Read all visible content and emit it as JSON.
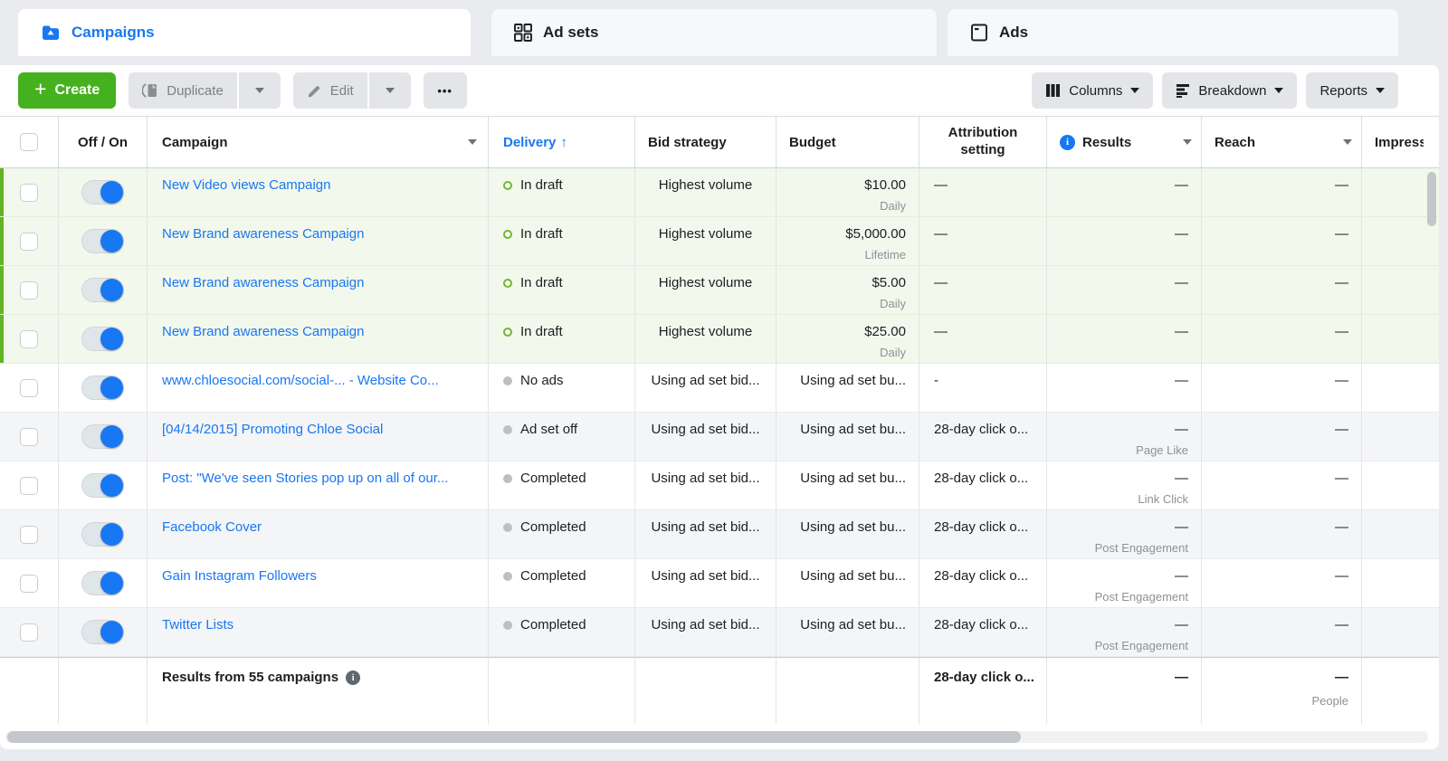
{
  "colors": {
    "accent_blue": "#1877f2",
    "create_green": "#45b11f",
    "draft_accent_green": "#63b324",
    "draft_row_bg": "#f2f8ec",
    "status_dot_gray": "#bcc0c5",
    "draft_ring_green": "#71b62c"
  },
  "tabs": [
    {
      "label": "Campaigns",
      "icon": "folder-icon",
      "active": true
    },
    {
      "label": "Ad sets",
      "icon": "grid-icon",
      "active": false
    },
    {
      "label": "Ads",
      "icon": "ad-page-icon",
      "active": false
    }
  ],
  "toolbar": {
    "create": "Create",
    "duplicate": "Duplicate",
    "edit": "Edit",
    "more": "•••",
    "columns": "Columns",
    "breakdown": "Breakdown",
    "reports": "Reports"
  },
  "table": {
    "headers": {
      "on_off": "Off / On",
      "campaign": "Campaign",
      "delivery": "Delivery",
      "delivery_sort": "↑",
      "bid": "Bid strategy",
      "budget": "Budget",
      "attribution": "Attribution setting",
      "results": "Results",
      "reach": "Reach",
      "impressions": "Impressions"
    },
    "rows": [
      {
        "name": "New Video views Campaign",
        "status": "In draft",
        "status_type": "draft",
        "bid": "Highest volume",
        "budget": "$10.00",
        "budget_period": "Daily",
        "attribution": "—",
        "result": "—",
        "result_label": "",
        "reach": "—",
        "style": "draft"
      },
      {
        "name": "New Brand awareness Campaign",
        "status": "In draft",
        "status_type": "draft",
        "bid": "Highest volume",
        "budget": "$5,000.00",
        "budget_period": "Lifetime",
        "attribution": "—",
        "result": "—",
        "result_label": "",
        "reach": "—",
        "style": "draft"
      },
      {
        "name": "New Brand awareness Campaign",
        "status": "In draft",
        "status_type": "draft",
        "bid": "Highest volume",
        "budget": "$5.00",
        "budget_period": "Daily",
        "attribution": "—",
        "result": "—",
        "result_label": "",
        "reach": "—",
        "style": "draft"
      },
      {
        "name": "New Brand awareness Campaign",
        "status": "In draft",
        "status_type": "draft",
        "bid": "Highest volume",
        "budget": "$25.00",
        "budget_period": "Daily",
        "attribution": "—",
        "result": "—",
        "result_label": "",
        "reach": "—",
        "style": "draft"
      },
      {
        "name": "www.chloesocial.com/social-... - Website Co...",
        "status": "No ads",
        "status_type": "off",
        "bid": "Using ad set bid...",
        "budget": "Using ad set bu...",
        "budget_period": "",
        "attribution": "-",
        "result": "—",
        "result_label": "",
        "reach": "—",
        "style": "plain"
      },
      {
        "name": "[04/14/2015] Promoting Chloe Social",
        "status": "Ad set off",
        "status_type": "off",
        "bid": "Using ad set bid...",
        "budget": "Using ad set bu...",
        "budget_period": "",
        "attribution": "28-day click o...",
        "result": "—",
        "result_label": "Page Like",
        "reach": "—",
        "style": "alt"
      },
      {
        "name": "Post: \"We've seen Stories pop up on all of our...",
        "status": "Completed",
        "status_type": "off",
        "bid": "Using ad set bid...",
        "budget": "Using ad set bu...",
        "budget_period": "",
        "attribution": "28-day click o...",
        "result": "—",
        "result_label": "Link Click",
        "reach": "—",
        "style": "plain"
      },
      {
        "name": "Facebook Cover",
        "status": "Completed",
        "status_type": "off",
        "bid": "Using ad set bid...",
        "budget": "Using ad set bu...",
        "budget_period": "",
        "attribution": "28-day click o...",
        "result": "—",
        "result_label": "Post Engagement",
        "reach": "—",
        "style": "alt"
      },
      {
        "name": "Gain Instagram Followers",
        "status": "Completed",
        "status_type": "off",
        "bid": "Using ad set bid...",
        "budget": "Using ad set bu...",
        "budget_period": "",
        "attribution": "28-day click o...",
        "result": "—",
        "result_label": "Post Engagement",
        "reach": "—",
        "style": "plain"
      },
      {
        "name": "Twitter Lists",
        "status": "Completed",
        "status_type": "off",
        "bid": "Using ad set bid...",
        "budget": "Using ad set bu...",
        "budget_period": "",
        "attribution": "28-day click o...",
        "result": "—",
        "result_label": "Post Engagement",
        "reach": "—",
        "style": "alt"
      }
    ],
    "footer": {
      "summary": "Results from 55 campaigns",
      "attribution": "28-day click o...",
      "results": "—",
      "reach": "—",
      "reach_label": "People"
    }
  }
}
